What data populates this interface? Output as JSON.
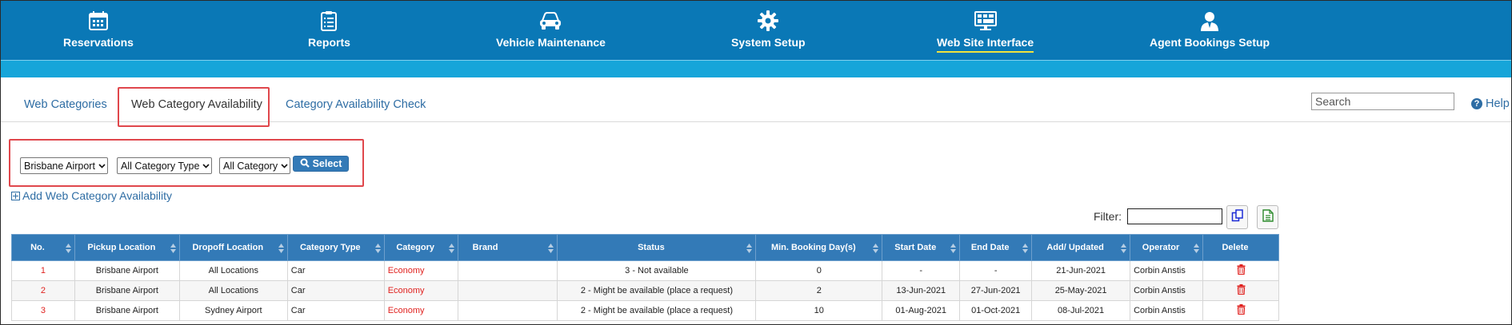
{
  "nav": {
    "items": [
      {
        "label": "Reservations",
        "icon": "calendar-icon"
      },
      {
        "label": "Reports",
        "icon": "clipboard-icon"
      },
      {
        "label": "Vehicle Maintenance",
        "icon": "car-icon"
      },
      {
        "label": "System Setup",
        "icon": "gear-icon"
      },
      {
        "label": "Web Site Interface",
        "icon": "monitor-icon",
        "active": true
      },
      {
        "label": "Agent Bookings Setup",
        "icon": "agent-icon"
      }
    ]
  },
  "tabs": {
    "items": [
      {
        "label": "Web Categories"
      },
      {
        "label": "Web Category Availability",
        "active": true
      },
      {
        "label": "Category Availability Check"
      }
    ],
    "search_placeholder": "Search",
    "help_label": "Help"
  },
  "filters": {
    "location": "Brisbane Airport",
    "category_type": "All Category Type",
    "category": "All Category",
    "select_label": "Select"
  },
  "add_label": "Add Web Category Availability",
  "filter_label": "Filter:",
  "filter_value": "",
  "table": {
    "headers": [
      "No.",
      "Pickup Location",
      "Dropoff Location",
      "Category Type",
      "Category",
      "Brand",
      "Status",
      "Min. Booking Day(s)",
      "Start Date",
      "End Date",
      "Add/ Updated",
      "Operator",
      "Delete"
    ],
    "rows": [
      [
        "1",
        "Brisbane Airport",
        "All Locations",
        "Car",
        "Economy",
        "",
        "3 - Not available",
        "0",
        "-",
        "-",
        "21-Jun-2021",
        "Corbin Anstis"
      ],
      [
        "2",
        "Brisbane Airport",
        "All Locations",
        "Car",
        "Economy",
        "",
        "2 - Might be available (place a request)",
        "2",
        "13-Jun-2021",
        "27-Jun-2021",
        "25-May-2021",
        "Corbin Anstis"
      ],
      [
        "3",
        "Brisbane Airport",
        "Sydney Airport",
        "Car",
        "Economy",
        "",
        "2 - Might be available (place a request)",
        "10",
        "01-Aug-2021",
        "01-Oct-2021",
        "08-Jul-2021",
        "Corbin Anstis"
      ]
    ]
  },
  "colors": {
    "nav_bg": "#0a78b6",
    "sub_band": "#16a5d9",
    "table_header": "#337ab7",
    "link": "#2e6da4",
    "highlight_box": "#e0474c",
    "accent_red": "#e0221f"
  }
}
